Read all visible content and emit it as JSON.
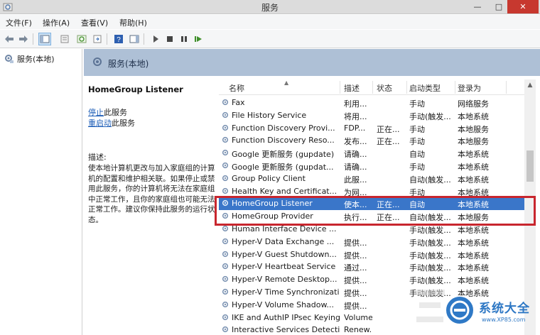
{
  "window": {
    "title": "服务",
    "min": "—",
    "max": "□",
    "close": "✕"
  },
  "menu": [
    "文件(F)",
    "操作(A)",
    "查看(V)",
    "帮助(H)"
  ],
  "tree": {
    "root_label": "服务(本地)"
  },
  "header": {
    "title": "服务(本地)"
  },
  "detail": {
    "service_name": "HomeGroup Listener",
    "stop_link": "停止",
    "stop_suffix": "此服务",
    "restart_link": "重启动",
    "restart_suffix": "此服务",
    "desc_label": "描述:",
    "desc_text": "使本地计算机更改与加入家庭组的计算机的配置和维护相关联。如果停止或禁用此服务，你的计算机将无法在家庭组中正常工作，且你的家庭组也可能无法正常工作。建议你保持此服务的运行状态。"
  },
  "columns": {
    "name": "名称",
    "desc": "描述",
    "status": "状态",
    "startup": "启动类型",
    "logon": "登录为"
  },
  "services": [
    {
      "name": "Fax",
      "desc": "利用...",
      "status": "",
      "startup": "手动",
      "logon": "网络服务"
    },
    {
      "name": "File History Service",
      "desc": "将用...",
      "status": "",
      "startup": "手动(触发...",
      "logon": "本地系统"
    },
    {
      "name": "Function Discovery Provi...",
      "desc": "FDP...",
      "status": "正在...",
      "startup": "手动",
      "logon": "本地服务"
    },
    {
      "name": "Function Discovery Reso...",
      "desc": "发布...",
      "status": "正在...",
      "startup": "手动",
      "logon": "本地服务"
    },
    {
      "name": "Google 更新服务 (gupdate)",
      "desc": "请确...",
      "status": "",
      "startup": "自动",
      "logon": "本地系统"
    },
    {
      "name": "Google 更新服务 (gupdat...",
      "desc": "请确...",
      "status": "",
      "startup": "手动",
      "logon": "本地系统"
    },
    {
      "name": "Group Policy Client",
      "desc": "此服...",
      "status": "",
      "startup": "自动(触发...",
      "logon": "本地系统"
    },
    {
      "name": "Health Key and Certificat...",
      "desc": "为网...",
      "status": "",
      "startup": "手动",
      "logon": "本地系统"
    },
    {
      "name": "HomeGroup Listener",
      "desc": "使本...",
      "status": "正在...",
      "startup": "自动",
      "logon": "本地系统"
    },
    {
      "name": "HomeGroup Provider",
      "desc": "执行...",
      "status": "正在...",
      "startup": "自动(触发...",
      "logon": "本地服务"
    },
    {
      "name": "Human Interface Device ...",
      "desc": "",
      "status": "",
      "startup": "手动(触发...",
      "logon": "本地系统"
    },
    {
      "name": "Hyper-V Data Exchange ...",
      "desc": "提供...",
      "status": "",
      "startup": "手动(触发...",
      "logon": "本地系统"
    },
    {
      "name": "Hyper-V Guest Shutdown...",
      "desc": "提供...",
      "status": "",
      "startup": "手动(触发...",
      "logon": "本地系统"
    },
    {
      "name": "Hyper-V Heartbeat Service",
      "desc": "通过...",
      "status": "",
      "startup": "手动(触发...",
      "logon": "本地系统"
    },
    {
      "name": "Hyper-V Remote Desktop...",
      "desc": "提供...",
      "status": "",
      "startup": "手动(触发...",
      "logon": "本地系统"
    },
    {
      "name": "Hyper-V Time Synchronization...",
      "desc": "提供...",
      "status": "",
      "startup": "手动(触发...",
      "logon": "本地系统"
    },
    {
      "name": "Hyper-V Volume Shadow...",
      "desc": "提供...",
      "status": "",
      "startup": "",
      "logon": ""
    },
    {
      "name": "IKE and AuthIP IPsec Keying...",
      "desc": "Volume...",
      "status": "",
      "startup": "",
      "logon": ""
    },
    {
      "name": "Interactive Services Detection",
      "desc": "Renew...",
      "status": "",
      "startup": "",
      "logon": ""
    }
  ],
  "selected_index": 8,
  "watermark": {
    "text": "系统大全",
    "url": "www.XP85.com"
  },
  "colors": {
    "selected_row": "#3a76c9",
    "header_band": "#aec0d6",
    "highlight_box": "#c8262e",
    "link": "#1f5fb8"
  }
}
